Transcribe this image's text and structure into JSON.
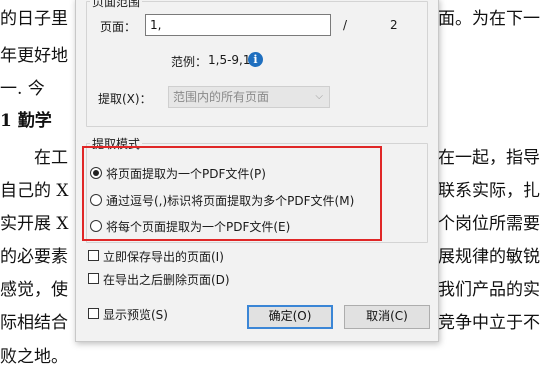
{
  "document": {
    "lines": [
      {
        "left": "的日子里",
        "right": "面。为在下一"
      },
      {
        "left": "年更好地",
        "right": ""
      },
      {
        "left": "一.   今",
        "right": ""
      },
      {
        "left": "1   勤学",
        "right": ""
      },
      {
        "left": "在工",
        "right": "在一起，指导"
      },
      {
        "left": "自己的 X",
        "right": "联系实际，扎"
      },
      {
        "left": "实开展 X",
        "right": "个岗位所需要"
      },
      {
        "left": "的必要素",
        "right": "展规律的敏锐"
      },
      {
        "left": "感觉，使",
        "right": "我们产品的实"
      },
      {
        "left": "际相结合",
        "right": "竞争中立于不"
      },
      {
        "left": "败之地。",
        "right": ""
      }
    ]
  },
  "dialog": {
    "page_range": {
      "group_title": "页面范围",
      "pages_label": "页面：",
      "pages_value": "1,",
      "separator": "/",
      "total_pages": "2",
      "example_label": "范例：",
      "example_value": "1,5-9,12",
      "extract_label": "提取(X)：",
      "extract_select_value": "范围内的所有页面"
    },
    "extract_mode": {
      "group_title": "提取模式",
      "options": [
        {
          "label": "将页面提取为一个PDF文件(P)",
          "checked": true
        },
        {
          "label": "通过逗号(,)标识将页面提取为多个PDF文件(M)",
          "checked": false
        },
        {
          "label": "将每个页面提取为一个PDF文件(E)",
          "checked": false
        }
      ]
    },
    "checkboxes": [
      {
        "label": "立即保存导出的页面(I)",
        "checked": false
      },
      {
        "label": "在导出之后删除页面(D)",
        "checked": false
      },
      {
        "label": "显示预览(S)",
        "checked": false
      }
    ],
    "buttons": {
      "ok": "确定(O)",
      "cancel": "取消(C)"
    },
    "colors": {
      "highlight": "#e02727",
      "primary_border": "#3b86d6",
      "info_icon": "#1f6fbf"
    }
  }
}
